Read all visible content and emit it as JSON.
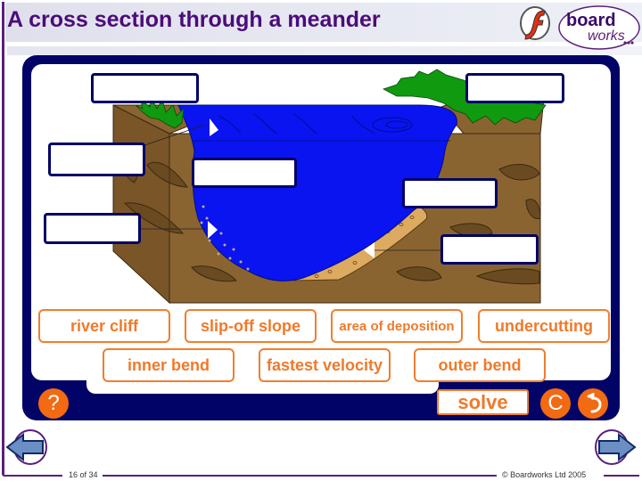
{
  "header": {
    "title": "A cross section through a meander"
  },
  "logos": {
    "flash": "flash-logo",
    "brand_top": "board",
    "brand_bottom": "works"
  },
  "diagram": {
    "label_boxes": [
      {
        "id": "box-1",
        "value": ""
      },
      {
        "id": "box-2",
        "value": ""
      },
      {
        "id": "box-3",
        "value": ""
      },
      {
        "id": "box-4",
        "value": ""
      },
      {
        "id": "box-5",
        "value": ""
      },
      {
        "id": "box-6",
        "value": ""
      },
      {
        "id": "box-7",
        "value": ""
      }
    ]
  },
  "word_bank": [
    {
      "label": "river cliff"
    },
    {
      "label": "slip-off slope"
    },
    {
      "label": "area of deposition"
    },
    {
      "label": "undercutting"
    },
    {
      "label": "inner bend"
    },
    {
      "label": "fastest velocity"
    },
    {
      "label": "outer bend"
    }
  ],
  "controls": {
    "help_label": "?",
    "solve_label": "solve",
    "clear_label": "C",
    "undo_icon": "undo-icon"
  },
  "colors": {
    "panel": "#010366",
    "accent": "#f26a12",
    "title": "#4b0c7a",
    "water": "#0a14f0",
    "soil": "#8a6430",
    "grass": "#109a10",
    "sand": "#dcaa60"
  },
  "footer": {
    "page": "16 of 34",
    "copyright": "© Boardworks Ltd 2005"
  }
}
